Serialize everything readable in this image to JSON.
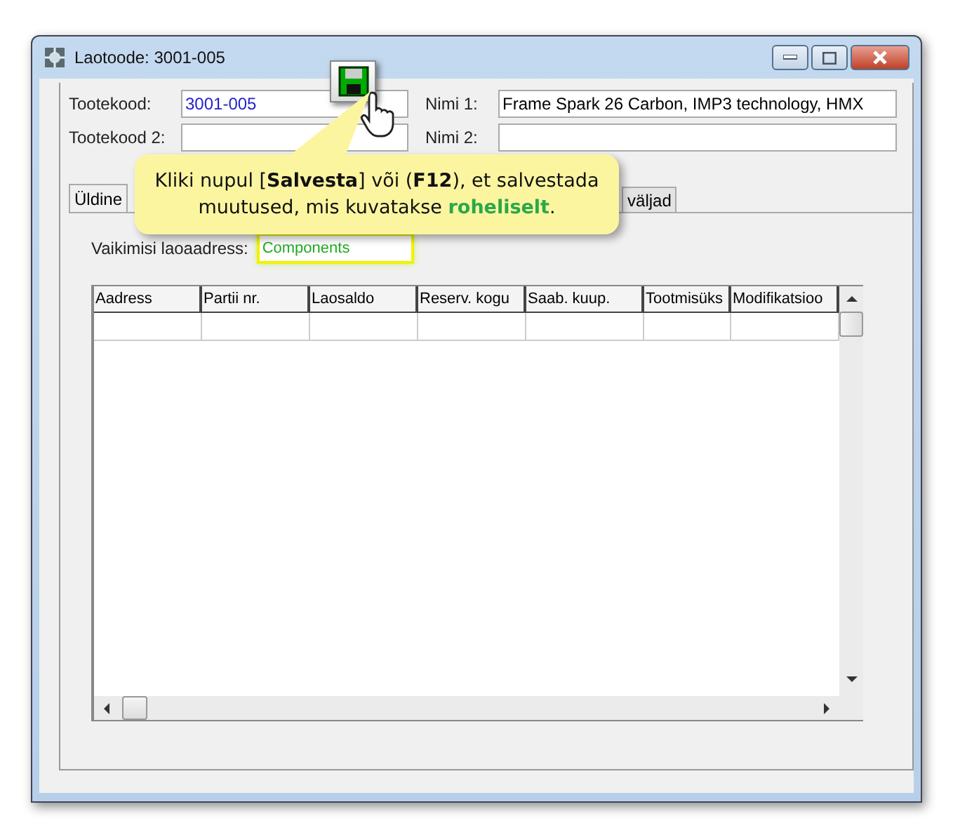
{
  "window": {
    "title": "Laotoode: 3001-005"
  },
  "fields": [
    {
      "label": "Tootekood:",
      "value": "3001-005"
    },
    {
      "label": "Nimi 1:",
      "value": "Frame Spark 26 Carbon, IMP3 technology, HMX"
    },
    {
      "label": "Tootekood 2:"
    },
    {
      "label": "Nimi 2:"
    }
  ],
  "tabs": [
    {
      "label": "Üldine",
      "selected": true
    },
    {
      "label": "väljad",
      "selected": false
    }
  ],
  "default_address": {
    "label": "Vaikimisi laoaadress:",
    "value": "Components"
  },
  "table": {
    "columns": [
      "Aadress",
      "Partii nr.",
      "Laosaldo",
      "Reserv. kogu",
      "Saab. kuup.",
      "Tootmisüks",
      "Modifikatsioo"
    ]
  },
  "callout": {
    "text": "Kliki nupul [**Salvesta**] või (**F12**), et salvestada muutused, mis kuvatakse ",
    "highlight": "roheliselt",
    "end": "."
  }
}
